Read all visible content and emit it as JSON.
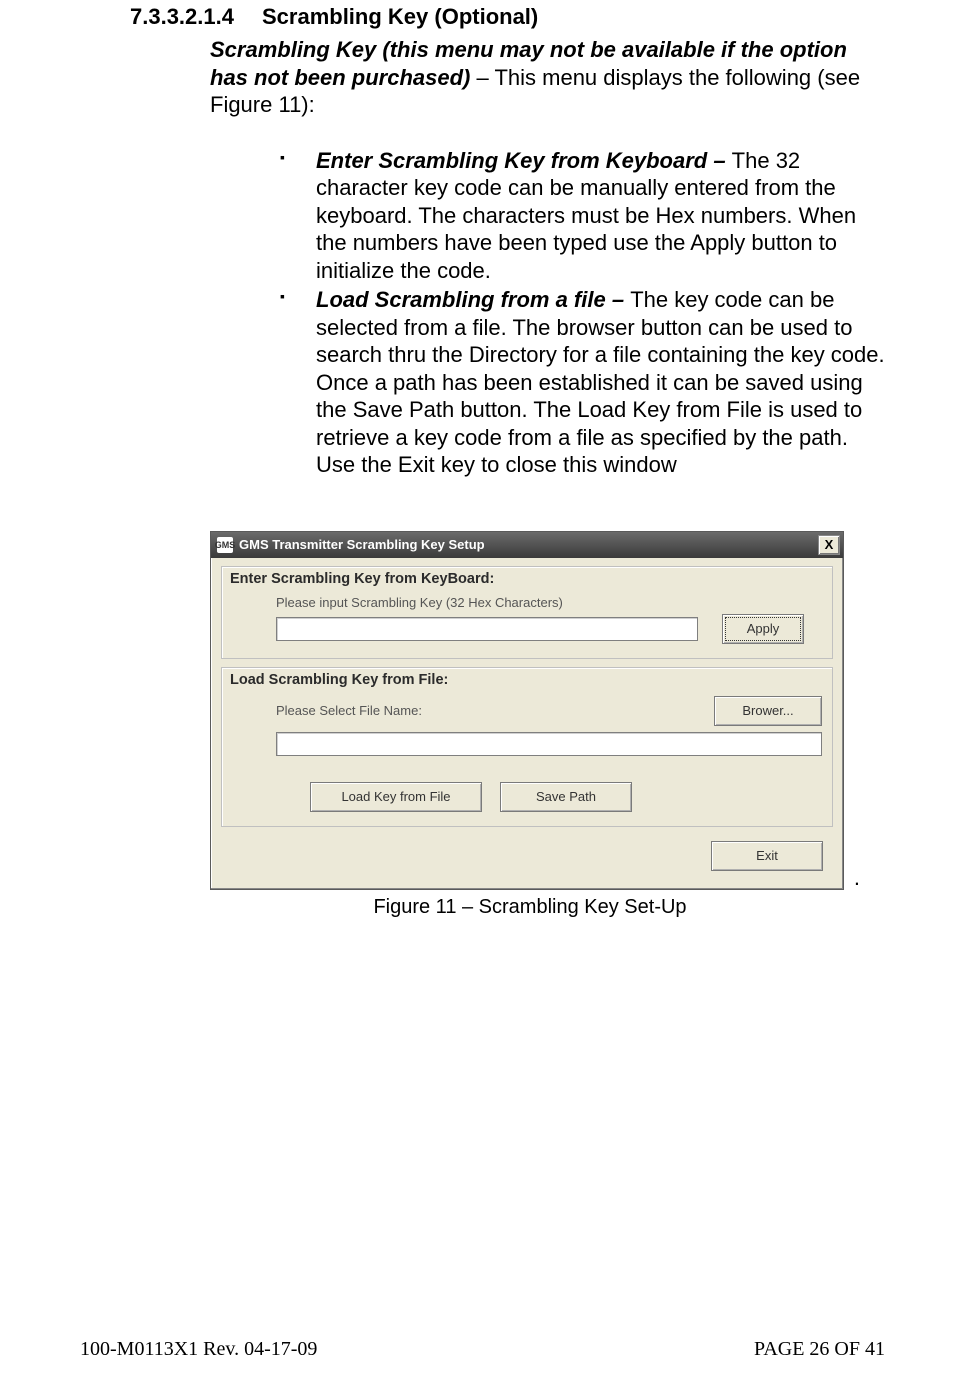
{
  "section": {
    "number": "7.3.3.2.1.4",
    "title": "Scrambling Key (Optional)"
  },
  "intro": {
    "emph": "Scrambling Key (this menu may not be available if the option has not been purchased)",
    "rest": " – This menu displays the following (see Figure 11):"
  },
  "bullets": [
    {
      "lead": "Enter Scrambling Key from Keyboard – ",
      "text": "The 32 character key code can be manually entered from the keyboard. The characters must be Hex numbers. When the numbers have been typed use the Apply button to initialize the code."
    },
    {
      "lead": "Load Scrambling from a file – ",
      "text": "The key code can be selected from a file. The browser button can be used to search thru the Directory for a file containing the key code. Once a path has been established it can be saved using the Save Path button. The Load Key from File is used to retrieve a key code from a file as specified by the path. Use the Exit key to close this window"
    }
  ],
  "dialog": {
    "icon_text": "GMS",
    "title": "GMS Transmitter Scrambling Key Setup",
    "close_glyph": "X",
    "group1": {
      "legend": "Enter Scrambling Key from KeyBoard:",
      "hint": "Please input Scrambling Key (32 Hex Characters)",
      "apply": "Apply"
    },
    "group2": {
      "legend": "Load Scrambling Key from File:",
      "hint": "Please Select File Name:",
      "browse": "Brower...",
      "load": "Load Key from File",
      "save": "Save Path"
    },
    "exit": "Exit"
  },
  "caption": "Figure 11 – Scrambling Key Set-Up",
  "footer": {
    "left": "100-M0113X1 Rev. 04-17-09",
    "right": "PAGE 26 OF 41"
  }
}
